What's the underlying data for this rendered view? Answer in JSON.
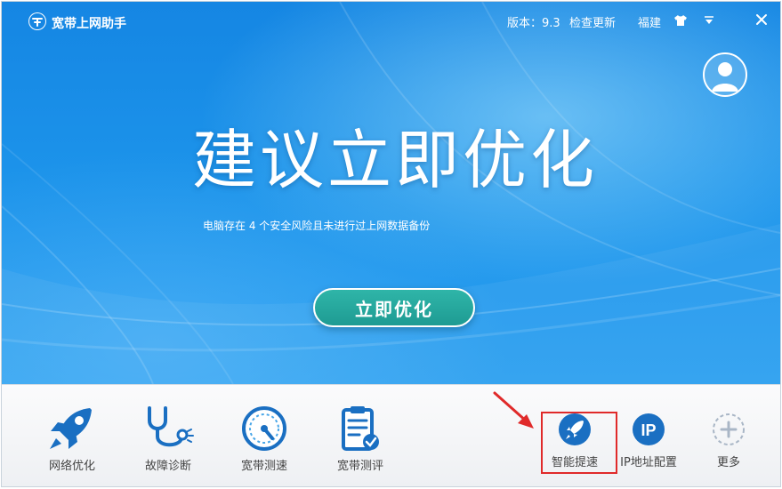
{
  "titlebar": {
    "app_title": "宽带上网助手",
    "version": "版本：9.3",
    "check_update": "检查更新",
    "region": "福建"
  },
  "hero": {
    "headline": "建议立即优化",
    "subline": "电脑存在 4 个安全风险且未进行过上网数据备份",
    "cta_label": "立即优化"
  },
  "toolbar": {
    "big_tools": [
      {
        "label": "网络优化",
        "icon": "rocket-icon"
      },
      {
        "label": "故障诊断",
        "icon": "stethoscope-icon"
      },
      {
        "label": "宽带测速",
        "icon": "speedometer-icon"
      },
      {
        "label": "宽带测评",
        "icon": "clipboard-check-icon"
      }
    ],
    "small_tools": [
      {
        "label": "智能提速",
        "icon": "rocket-circle-icon"
      },
      {
        "label": "IP地址配置",
        "icon": "ip-circle-icon",
        "icon_text": "IP"
      },
      {
        "label": "更多",
        "icon": "plus-circle-icon"
      }
    ]
  },
  "colors": {
    "hero_blue": "#1c93ea",
    "cta_teal": "#1e9b93",
    "icon_blue": "#1a6fc2",
    "highlight_red": "#e02a2a"
  }
}
